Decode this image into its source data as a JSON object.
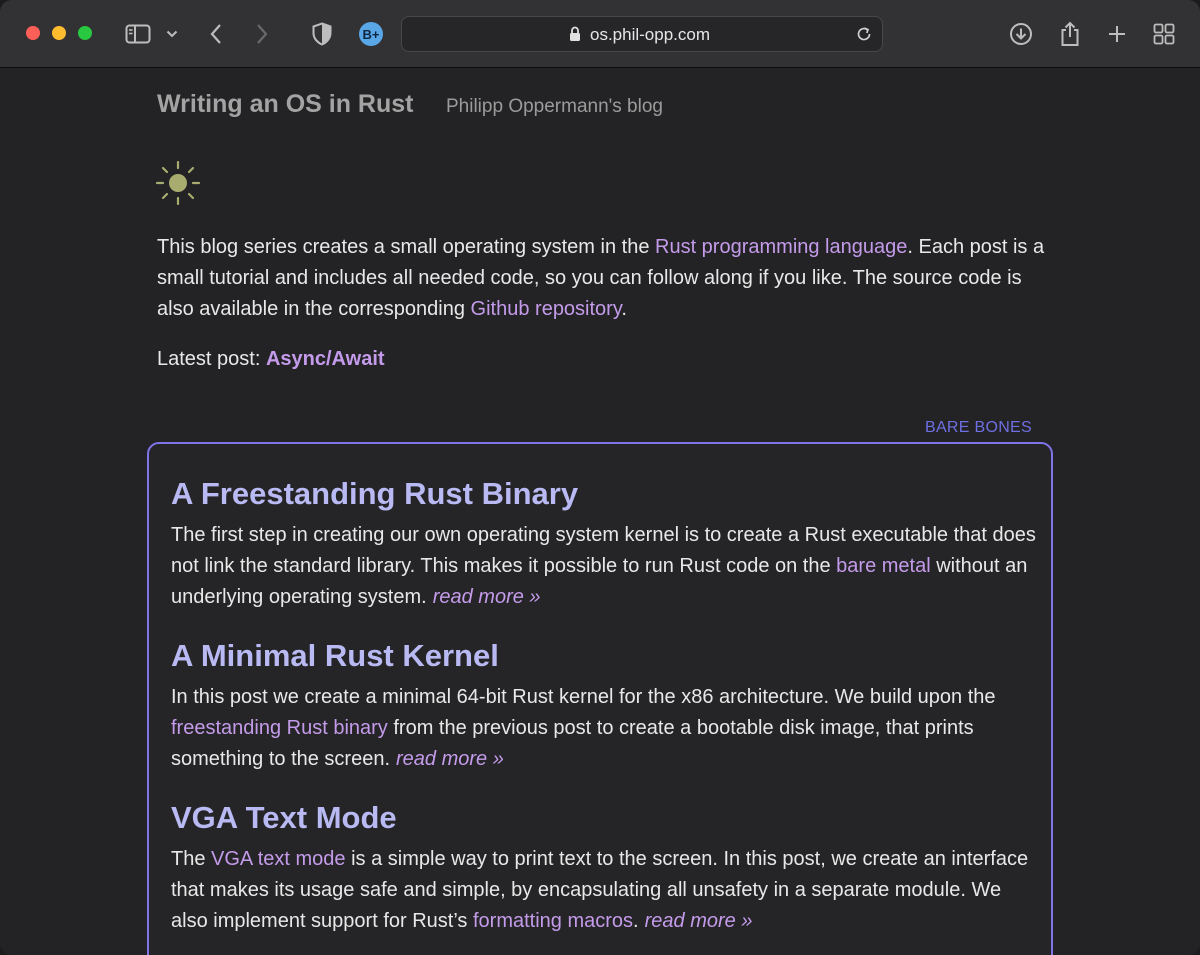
{
  "browser": {
    "url": "os.phil-opp.com",
    "extension_badge": "B+",
    "icons": [
      "sidebar-icon",
      "chevron-down-icon",
      "back-icon",
      "forward-icon",
      "shield-icon",
      "lock-icon",
      "reload-icon",
      "download-icon",
      "share-icon",
      "plus-icon",
      "tab-overview-icon"
    ]
  },
  "header": {
    "title": "Writing an OS in Rust",
    "subtitle": "Philipp Oppermann's blog"
  },
  "intro": {
    "part1": "This blog series creates a small operating system in the ",
    "link1": "Rust programming language",
    "part2": ". Each post is a small tutorial and includes all needed code, so you can follow along if you like. The source code is also available in the corresponding ",
    "link2": "Github repository",
    "part3": "."
  },
  "latest": {
    "label": "Latest post: ",
    "link": "Async/Await"
  },
  "section": {
    "label": "BARE BONES"
  },
  "posts": [
    {
      "title": "A Freestanding Rust Binary",
      "text1": "The first step in creating our own operating system kernel is to create a Rust executable that does not link the standard library. This makes it possible to run Rust code on the ",
      "link": "bare metal",
      "text2": " without an underlying operating system.",
      "readmore": "read more »"
    },
    {
      "title": "A Minimal Rust Kernel",
      "text1": "In this post we create a minimal 64-bit Rust kernel for the x86 architecture. We build upon the ",
      "link": "freestanding Rust binary",
      "text2": " from the previous post to create a bootable disk image, that prints something to the screen.",
      "readmore": "read more »"
    },
    {
      "title": "VGA Text Mode",
      "text1": "The ",
      "link": "VGA text mode",
      "text2": " is a simple way to print text to the screen. In this post, we create an interface that makes its usage safe and simple, by encapsulating all unsafety in a separate module. We also implement support for Rust’s ",
      "link2": "formatting macros",
      "text3": ".",
      "readmore": "read more »"
    }
  ],
  "colors": {
    "accent_link": "#c49bea",
    "post_title": "#b9b9f3",
    "box_border": "#7f74e8",
    "section_label": "#6f6fe4"
  }
}
